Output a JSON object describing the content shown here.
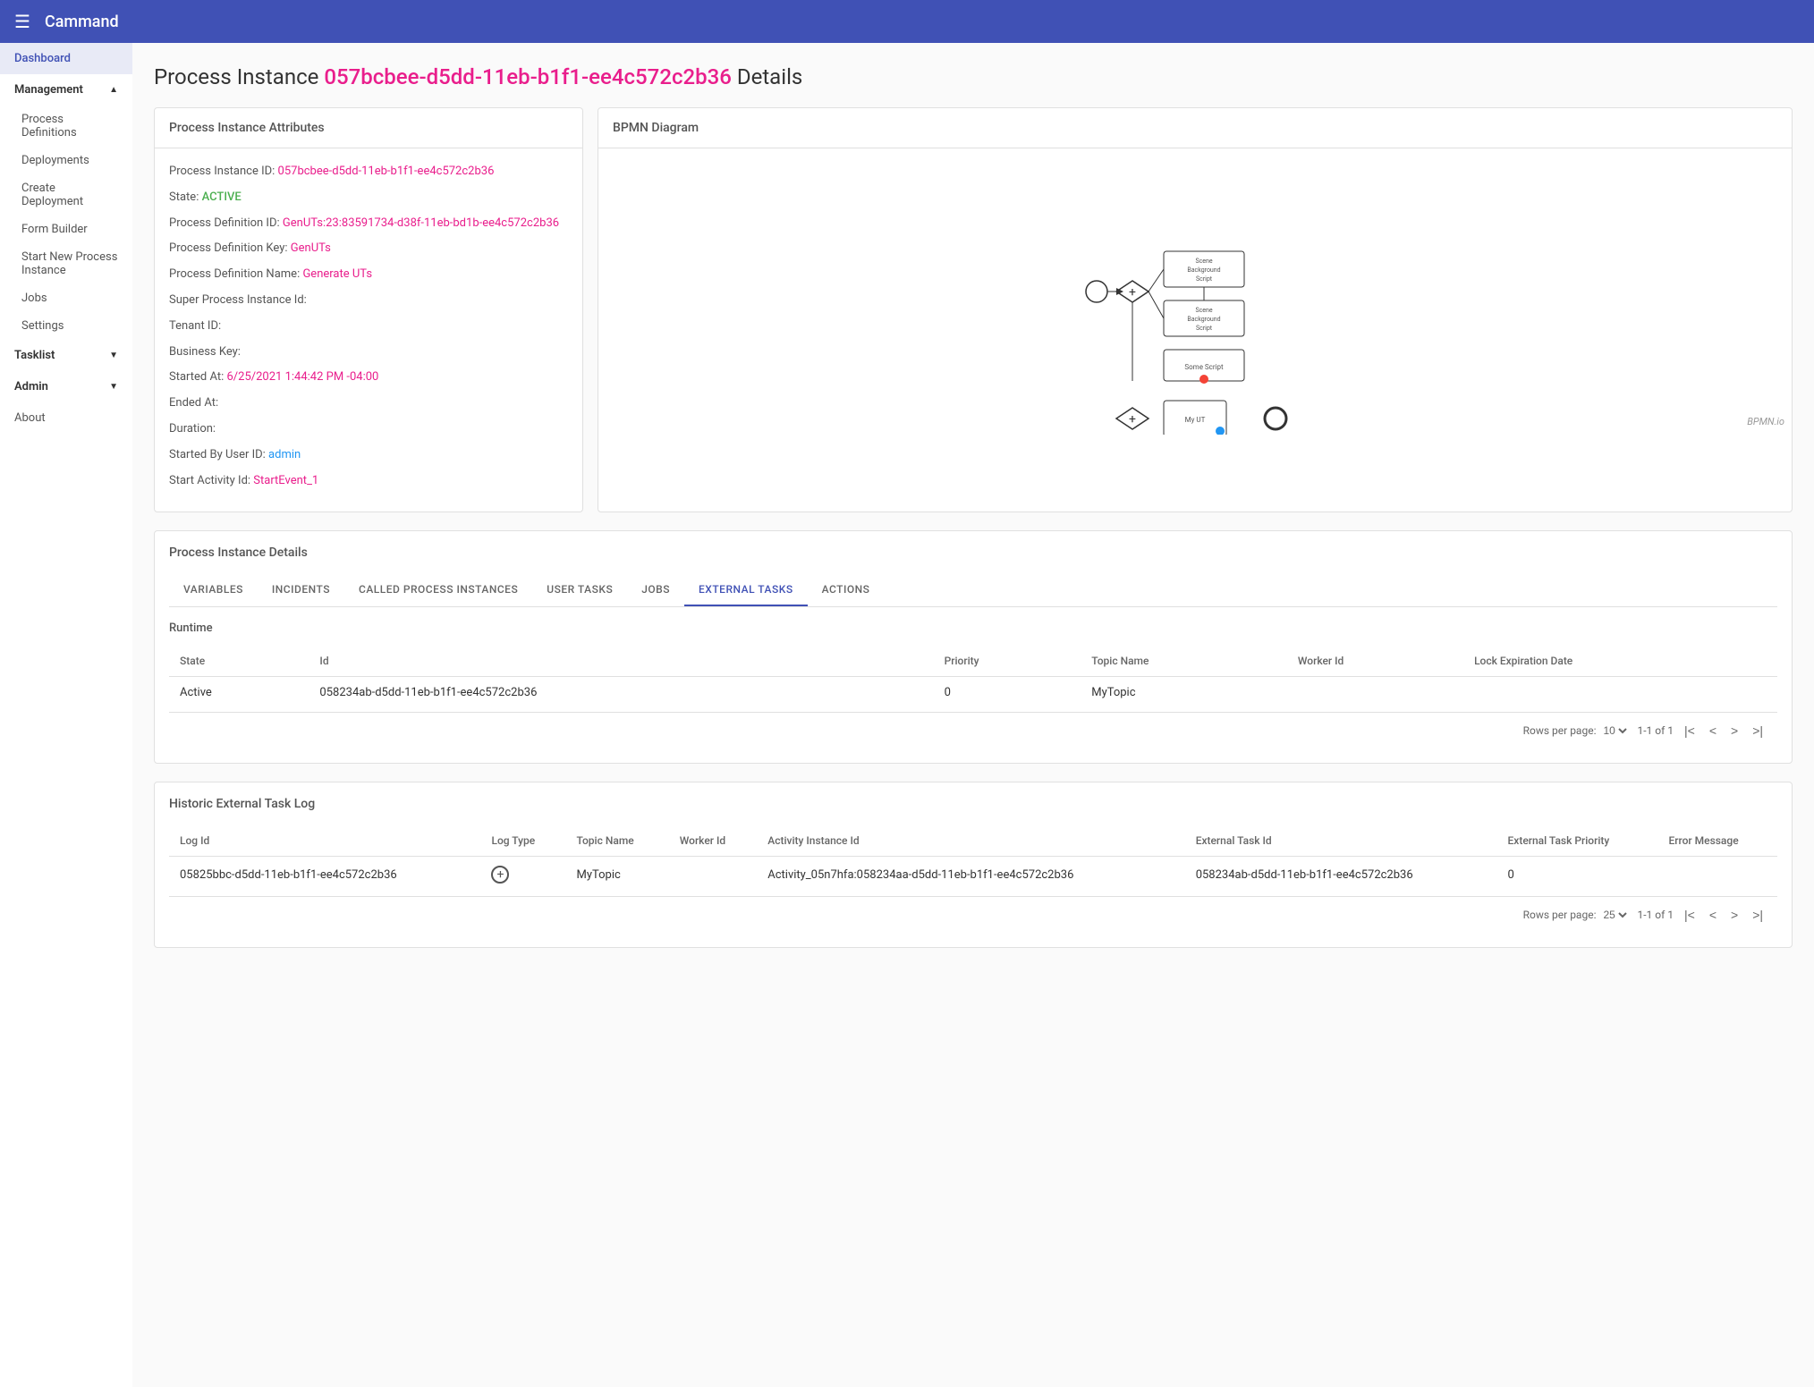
{
  "app": {
    "name": "Cammand",
    "menu_icon": "☰"
  },
  "sidebar": {
    "logo": "Cammand",
    "items": [
      {
        "id": "dashboard",
        "label": "Dashboard",
        "active": true,
        "level": 0
      },
      {
        "id": "management",
        "label": "Management",
        "level": 0,
        "expanded": true,
        "hasChevron": true
      },
      {
        "id": "process-definitions",
        "label": "Process Definitions",
        "level": 1
      },
      {
        "id": "deployments",
        "label": "Deployments",
        "level": 1
      },
      {
        "id": "create-deployment",
        "label": "Create Deployment",
        "level": 1
      },
      {
        "id": "form-builder",
        "label": "Form Builder",
        "level": 1
      },
      {
        "id": "start-new-process",
        "label": "Start New Process Instance",
        "level": 1
      },
      {
        "id": "jobs",
        "label": "Jobs",
        "level": 1
      },
      {
        "id": "settings",
        "label": "Settings",
        "level": 1
      },
      {
        "id": "tasklist",
        "label": "Tasklist",
        "level": 0,
        "hasChevron": true
      },
      {
        "id": "admin",
        "label": "Admin",
        "level": 0,
        "hasChevron": true
      },
      {
        "id": "about",
        "label": "About",
        "level": 0
      }
    ]
  },
  "page": {
    "title_prefix": "Process Instance",
    "title_id": "057bcbee-d5dd-11eb-b1f1-ee4c572c2b36",
    "title_suffix": "Details"
  },
  "attributes": {
    "section_title": "Process Instance Attributes",
    "fields": [
      {
        "label": "Process Instance ID:",
        "value": "057bcbee-d5dd-11eb-b1f1-ee4c572c2b36",
        "type": "link-pink"
      },
      {
        "label": "State:",
        "value": "ACTIVE",
        "type": "green"
      },
      {
        "label": "Process Definition ID:",
        "value": "GenUTs:23:83591734-d38f-11eb-bd1b-ee4c572c2b36",
        "type": "link-pink"
      },
      {
        "label": "Process Definition Key:",
        "value": "GenUTs",
        "type": "link-pink"
      },
      {
        "label": "Process Definition Name:",
        "value": "Generate UTs",
        "type": "link-pink"
      },
      {
        "label": "Super Process Instance Id:",
        "value": "",
        "type": "plain"
      },
      {
        "label": "Tenant ID:",
        "value": "",
        "type": "plain"
      },
      {
        "label": "Business Key:",
        "value": "",
        "type": "plain"
      },
      {
        "label": "Started At:",
        "value": "6/25/2021 1:44:42 PM -04:00",
        "type": "link-pink"
      },
      {
        "label": "Ended At:",
        "value": "",
        "type": "plain"
      },
      {
        "label": "Duration:",
        "value": "",
        "type": "plain"
      },
      {
        "label": "Started By User ID:",
        "value": "admin",
        "type": "link-blue"
      },
      {
        "label": "Start Activity Id:",
        "value": "StartEvent_1",
        "type": "link-pink"
      }
    ]
  },
  "bpmn": {
    "section_title": "BPMN Diagram",
    "watermark": "BPMN.io"
  },
  "details": {
    "section_title": "Process Instance Details",
    "tabs": [
      {
        "id": "variables",
        "label": "VARIABLES"
      },
      {
        "id": "incidents",
        "label": "INCIDENTS"
      },
      {
        "id": "called-process-instances",
        "label": "CALLED PROCESS INSTANCES"
      },
      {
        "id": "user-tasks",
        "label": "USER TASKS"
      },
      {
        "id": "jobs",
        "label": "JOBS"
      },
      {
        "id": "external-tasks",
        "label": "EXTERNAL TASKS",
        "active": true
      },
      {
        "id": "actions",
        "label": "ACTIONS"
      }
    ],
    "runtime_label": "Runtime",
    "table": {
      "columns": [
        "State",
        "Id",
        "Priority",
        "Topic Name",
        "Worker Id",
        "Lock Expiration Date"
      ],
      "rows": [
        {
          "state": "Active",
          "id": "058234ab-d5dd-11eb-b1f1-ee4c572c2b36",
          "priority": "0",
          "topic_name": "MyTopic",
          "worker_id": "",
          "lock_expiration_date": ""
        }
      ]
    },
    "pagination": {
      "rows_per_page_label": "Rows per page:",
      "rows_per_page": "10",
      "range": "1-1 of 1"
    }
  },
  "historic_log": {
    "title": "Historic External Task Log",
    "columns": [
      "Log Id",
      "Log Type",
      "Topic Name",
      "Worker Id",
      "Activity Instance Id",
      "External Task Id",
      "External Task Priority",
      "Error Message"
    ],
    "rows": [
      {
        "log_id": "05825bbc-d5dd-11eb-b1f1-ee4c572c2b36",
        "log_type_icon": "circle-plus",
        "topic_name": "MyTopic",
        "worker_id": "",
        "activity_instance_id": "Activity_05n7hfa:058234aa-d5dd-11eb-b1f1-ee4c572c2b36",
        "external_task_id": "058234ab-d5dd-11eb-b1f1-ee4c572c2b36",
        "external_task_priority": "0",
        "error_message": ""
      }
    ],
    "pagination": {
      "rows_per_page_label": "Rows per page:",
      "rows_per_page": "25",
      "range": "1-1 of 1"
    }
  }
}
